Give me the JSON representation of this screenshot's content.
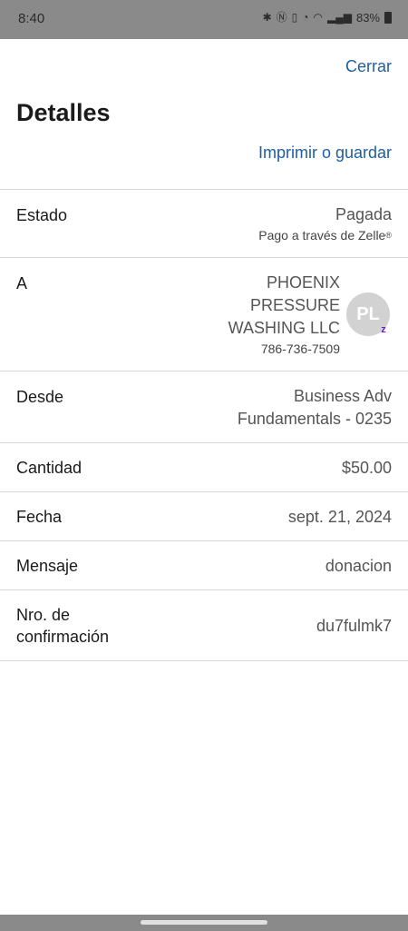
{
  "status_bar": {
    "time": "8:40",
    "battery": "83%",
    "icons": [
      "bluetooth-icon",
      "nfc-icon",
      "vibrate-icon",
      "alarm-icon",
      "wifi-icon",
      "signal-icon",
      "battery-icon"
    ]
  },
  "header": {
    "close_label": "Cerrar",
    "title": "Detalles",
    "print_label": "Imprimir o guardar"
  },
  "details": {
    "status": {
      "label": "Estado",
      "value": "Pagada",
      "sub": "Pago a través de Zelle",
      "sub_mark": "®"
    },
    "to": {
      "label": "A",
      "name_line1": "PHOENIX",
      "name_line2": "PRESSURE",
      "name_line3": "WASHING LLC",
      "phone": "786-736-7509",
      "avatar_initials": "PL",
      "badge": "z"
    },
    "from": {
      "label": "Desde",
      "value_line1": "Business Adv",
      "value_line2": "Fundamentals - 0235"
    },
    "amount": {
      "label": "Cantidad",
      "value": "$50.00"
    },
    "date": {
      "label": "Fecha",
      "value": "sept. 21, 2024"
    },
    "message": {
      "label": "Mensaje",
      "value": "donacion"
    },
    "confirmation": {
      "label_line1": "Nro. de",
      "label_line2": "confirmación",
      "value": "du7fulmk7"
    }
  },
  "colors": {
    "link": "#1d5fa3",
    "status_bar": "#8a8a8a",
    "zelle_purple": "#6d1ed4",
    "avatar": "#d2d2d2"
  }
}
